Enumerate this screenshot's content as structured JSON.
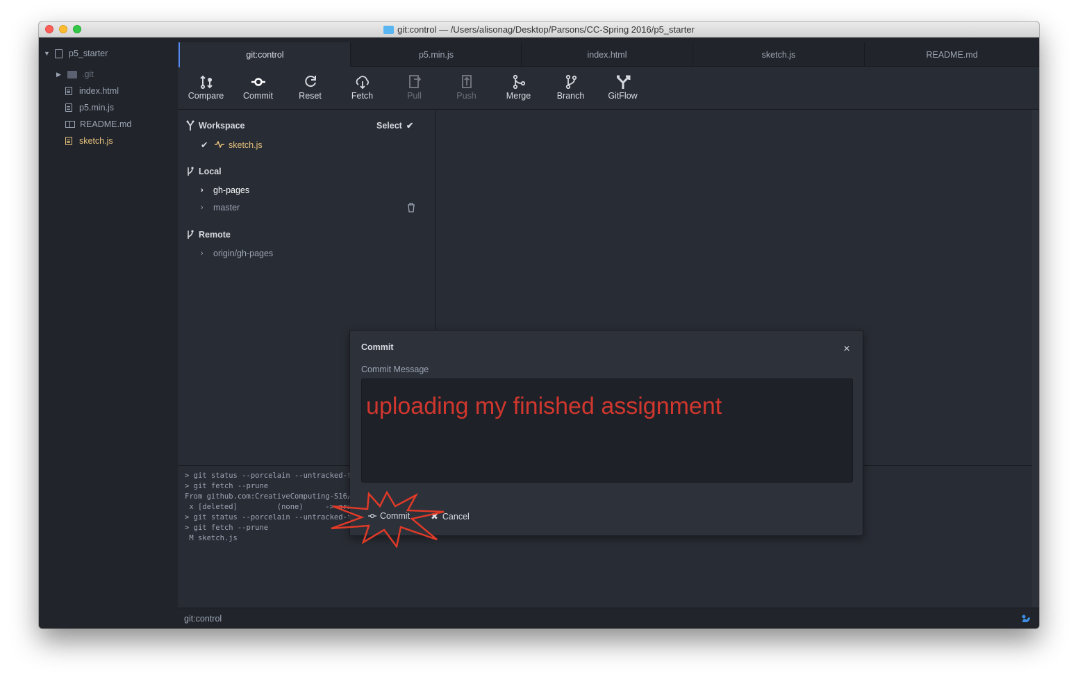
{
  "window": {
    "title": "git:control — /Users/alisonag/Desktop/Parsons/CC-Spring 2016/p5_starter"
  },
  "tree": {
    "project": "p5_starter",
    "items": [
      {
        "label": ".git",
        "type": "folder"
      },
      {
        "label": "index.html",
        "type": "file"
      },
      {
        "label": "p5.min.js",
        "type": "file"
      },
      {
        "label": "README.md",
        "type": "book"
      },
      {
        "label": "sketch.js",
        "type": "file",
        "selected": true
      }
    ]
  },
  "tabs": [
    {
      "label": "git:control",
      "active": true
    },
    {
      "label": "p5.min.js"
    },
    {
      "label": "index.html"
    },
    {
      "label": "sketch.js"
    },
    {
      "label": "README.md"
    }
  ],
  "toolbar": {
    "compare": "Compare",
    "commit": "Commit",
    "reset": "Reset",
    "fetch": "Fetch",
    "pull": "Pull",
    "push": "Push",
    "merge": "Merge",
    "branch": "Branch",
    "gitflow": "GitFlow"
  },
  "panel": {
    "workspace_label": "Workspace",
    "select_label": "Select",
    "workspace_file": "sketch.js",
    "local_label": "Local",
    "local_branches": [
      "gh-pages",
      "master"
    ],
    "remote_label": "Remote",
    "remote_branches": [
      "origin/gh-pages"
    ]
  },
  "console": {
    "lines": [
      "> git status --porcelain --untracked-files=all",
      "> git fetch --prune",
      "From github.com:CreativeComputing-S16/p5_starter",
      " x [deleted]         (none)     -> origin/master",
      "> git status --porcelain --untracked-files=all",
      "> git fetch --prune",
      " M sketch.js"
    ]
  },
  "statusbar": {
    "label": "git:control"
  },
  "modal": {
    "title": "Commit",
    "message_label": "Commit Message",
    "message_value": "uploading my finished assignment",
    "commit_button": "Commit",
    "cancel_button": "Cancel"
  },
  "colors": {
    "accent_blue": "#568af2",
    "selected_file": "#e5c07b",
    "annotation_red": "#d0372e"
  }
}
